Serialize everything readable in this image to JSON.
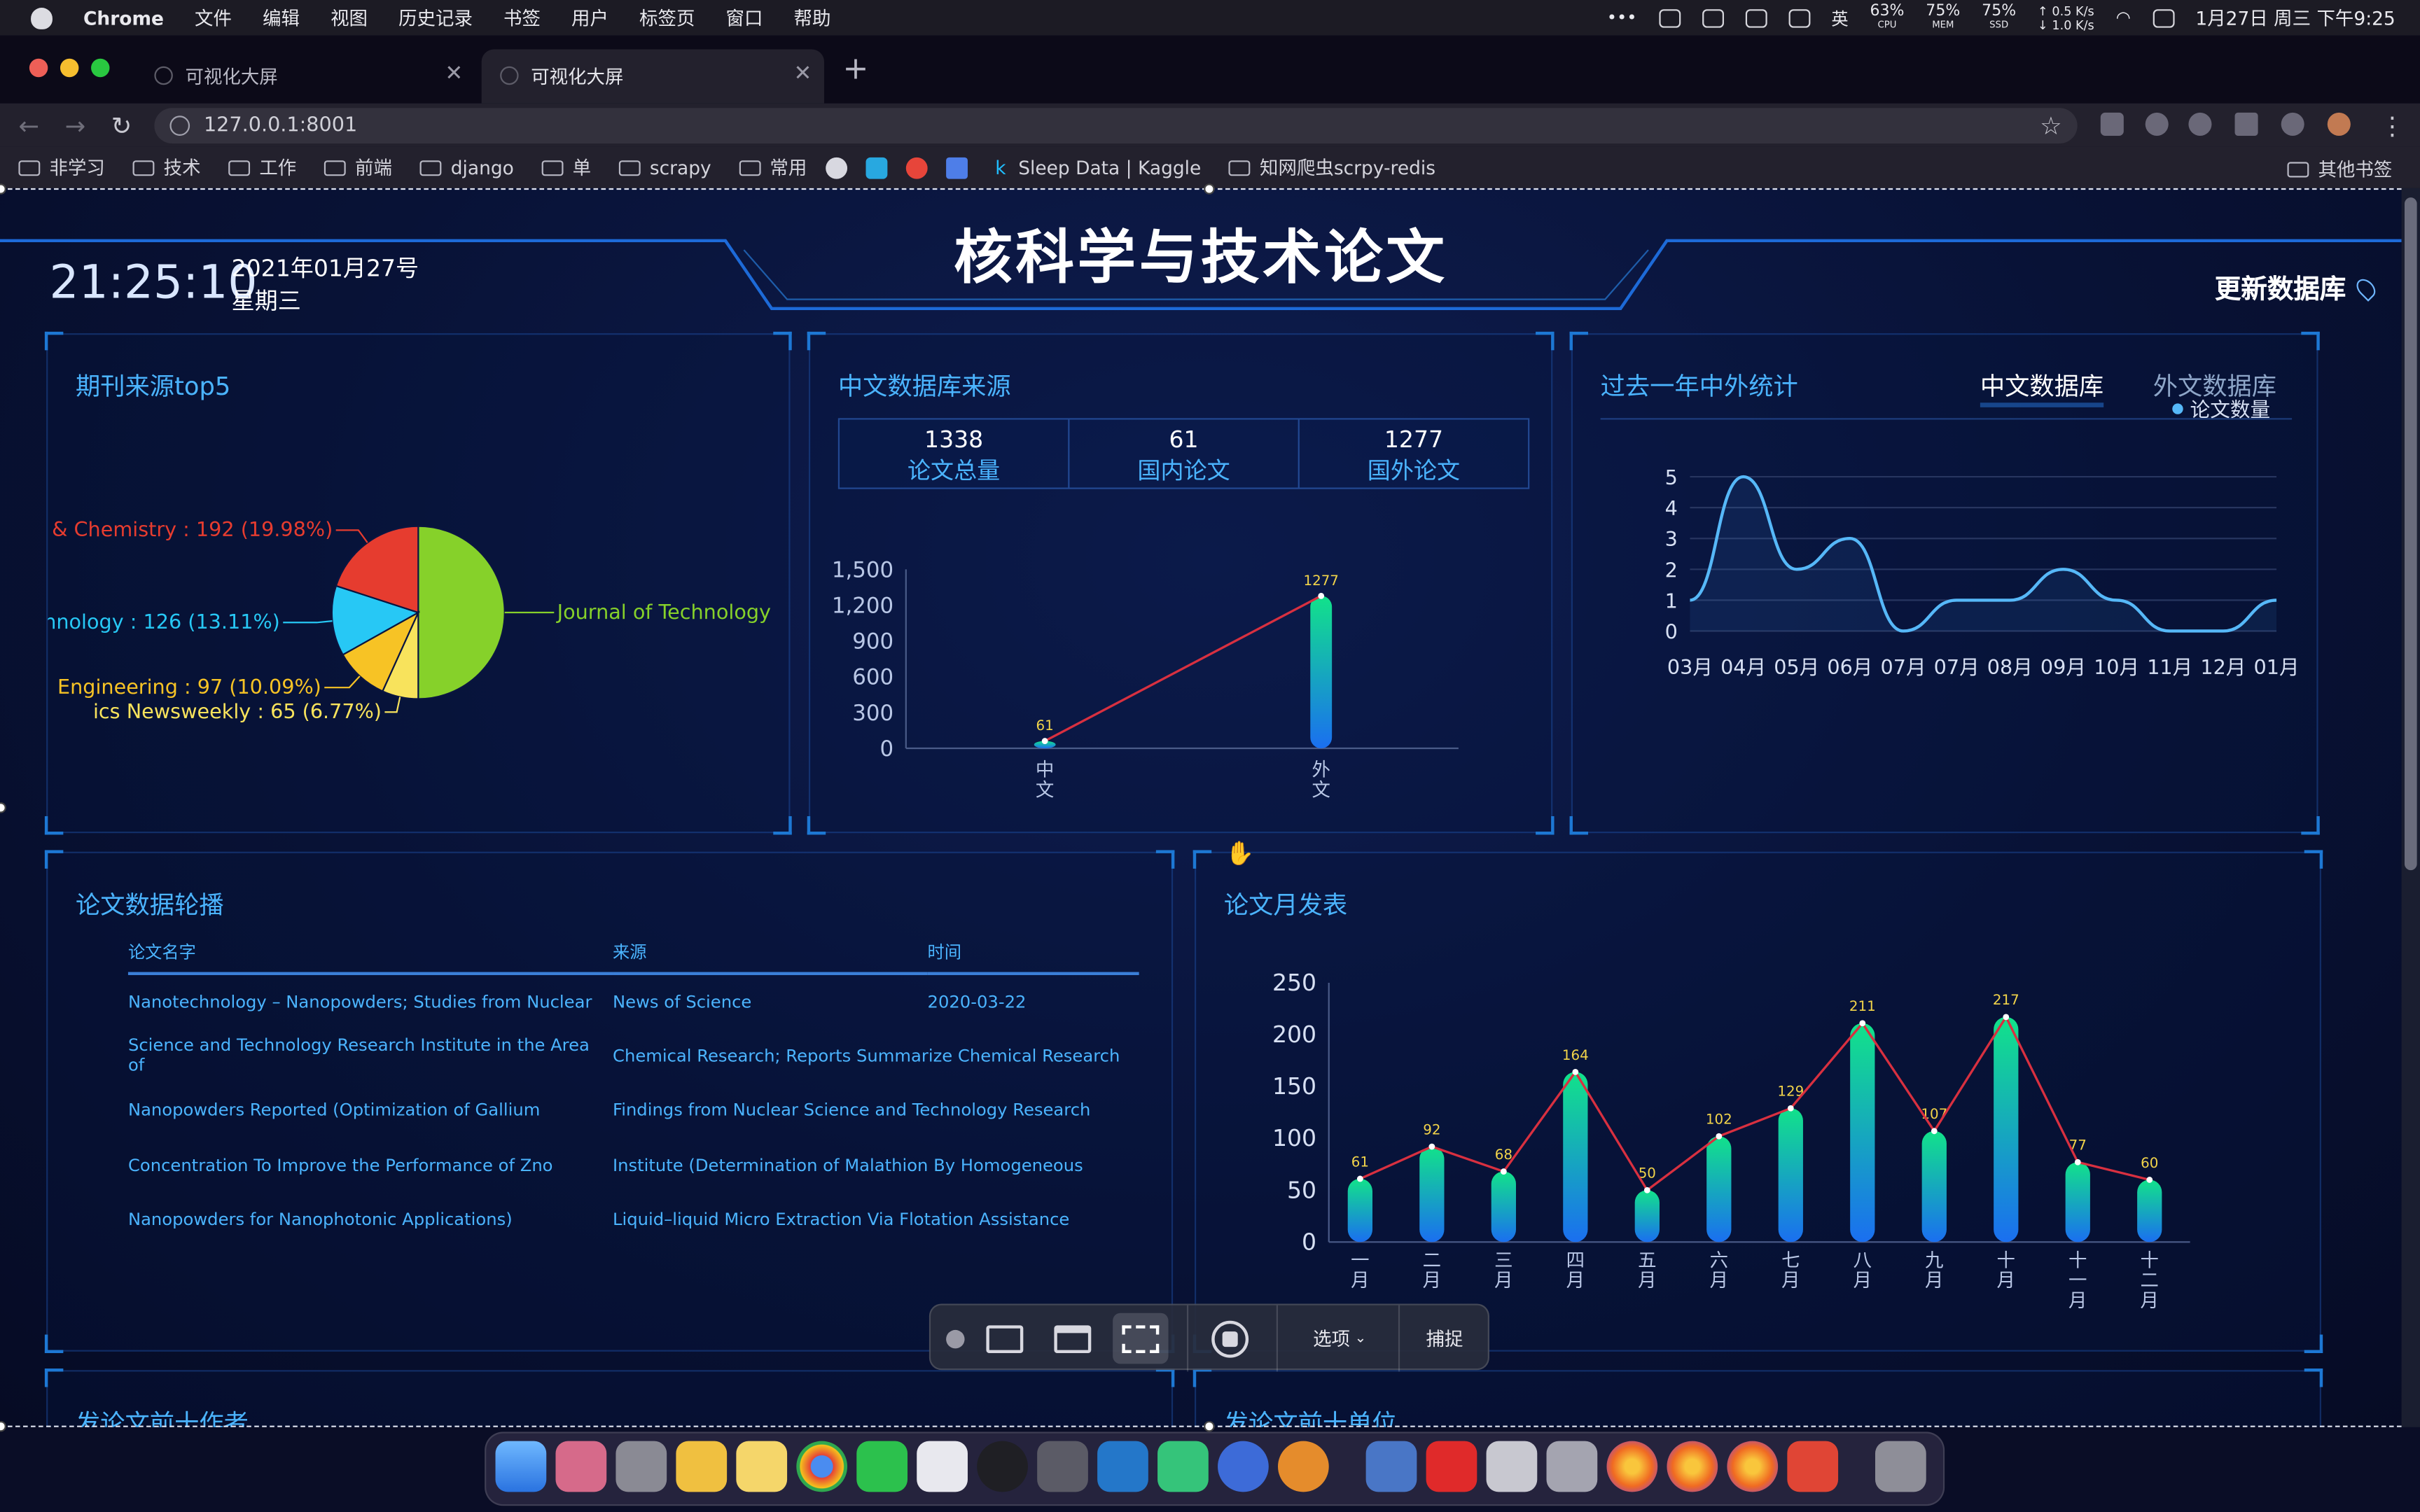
{
  "menubar": {
    "app": "Chrome",
    "items": [
      "文件",
      "编辑",
      "视图",
      "历史记录",
      "书签",
      "用户",
      "标签页",
      "窗口",
      "帮助"
    ],
    "cpu": "63%",
    "cpu_label": "CPU",
    "mem": "75%",
    "mem_label": "MEM",
    "ssd": "75%",
    "ssd_label": "SSD",
    "net_up": "↑ 0.5 K/s",
    "net_down": "↓ 1.0 K/s",
    "ime": "英",
    "datetime": "1月27日 周三 下午9:25"
  },
  "browser": {
    "tabs": [
      {
        "title": "可视化大屏"
      },
      {
        "title": "可视化大屏"
      }
    ],
    "url": "127.0.0.1:8001",
    "bookmarks": [
      "非学习",
      "技术",
      "工作",
      "前端",
      "django",
      "单",
      "scrapy",
      "常用",
      "Sleep Data | Kaggle",
      "知网爬虫scrpy-redis"
    ],
    "other_bookmarks": "其他书签"
  },
  "dashboard": {
    "title": "核科学与技术论文",
    "time": "21:25:10",
    "date": "2021年01月27号",
    "weekday": "星期三",
    "update_label": "更新数据库",
    "colors": {
      "accent": "#4bb4ff",
      "bg": "#081236",
      "panel_corner": "#1d78d4"
    }
  },
  "panel_journal": {
    "title": "期刊来源top5"
  },
  "panel_cn_source": {
    "title": "中文数据库来源",
    "stats": [
      {
        "value": "1338",
        "label": "论文总量"
      },
      {
        "value": "61",
        "label": "国内论文"
      },
      {
        "value": "1277",
        "label": "国外论文"
      }
    ]
  },
  "panel_year": {
    "title": "过去一年中外统计",
    "tab_cn": "中文数据库",
    "tab_foreign": "外文数据库"
  },
  "panel_carousel": {
    "title": "论文数据轮播",
    "columns": [
      "论文名字",
      "来源",
      "时间"
    ],
    "rows": [
      [
        "Nanotechnology – Nanopowders; Studies from Nuclear",
        "News of Science",
        "2020-03-22"
      ],
      [
        "Science and Technology Research Institute in the Area of",
        "Chemical Research; Reports Summarize Chemical Research",
        ""
      ],
      [
        "Nanopowders Reported (Optimization of Gallium",
        "Findings from Nuclear Science and Technology Research",
        ""
      ],
      [
        "Concentration To Improve the Performance of Zno",
        "Institute (Determination of Malathion By Homogeneous",
        ""
      ],
      [
        "Nanopowders for Nanophotonic Applications)",
        "Liquid–liquid Micro Extraction Via Flotation Assistance",
        ""
      ]
    ]
  },
  "panel_monthly": {
    "title": "论文月发表"
  },
  "panel_authors": {
    "title": "发论文前十作者"
  },
  "panel_units": {
    "title": "发论文前十单位"
  },
  "capture_toolbar": {
    "options": "选项",
    "capture": "捕捉"
  },
  "chart_data": [
    {
      "type": "pie",
      "labels": [
        "Journal of Technology",
        "ics Newsweekly : 65 (6.77%)",
        "Engineering : 97 (10.09%)",
        "chnology : 126 (13.11%)",
        "& Chemistry : 192 (19.98%)"
      ],
      "values": [
        480,
        65,
        97,
        126,
        192
      ],
      "colors": [
        "#86d12a",
        "#f8e35c",
        "#f7c325",
        "#27c8f5",
        "#e63c2f"
      ]
    },
    {
      "type": "bar",
      "categories": [
        "中文",
        "外文"
      ],
      "values": [
        61,
        1277
      ],
      "ylim": [
        0,
        1500
      ],
      "yticks": [
        "0",
        "300",
        "600",
        "900",
        "1,200",
        "1,500"
      ],
      "line_overlay": true
    },
    {
      "type": "line",
      "legend": "论文数量",
      "categories": [
        "03月",
        "04月",
        "05月",
        "06月",
        "07月",
        "07月",
        "08月",
        "09月",
        "10月",
        "11月",
        "12月",
        "01月"
      ],
      "values": [
        1,
        5,
        2,
        3,
        0,
        1,
        1,
        2,
        1,
        0,
        0,
        1
      ],
      "ylim": [
        0,
        5
      ],
      "yticks": [
        "0",
        "1",
        "2",
        "3",
        "4",
        "5"
      ]
    },
    {
      "type": "bar",
      "categories": [
        "一月",
        "二月",
        "三月",
        "四月",
        "五月",
        "六月",
        "七月",
        "八月",
        "九月",
        "十月",
        "十一月",
        "十二月"
      ],
      "values": [
        61,
        92,
        68,
        164,
        50,
        102,
        129,
        211,
        107,
        217,
        77,
        60
      ],
      "ylim": [
        0,
        250
      ],
      "yticks": [
        "0",
        "50",
        "100",
        "150",
        "200",
        "250"
      ],
      "line_overlay": true
    }
  ]
}
